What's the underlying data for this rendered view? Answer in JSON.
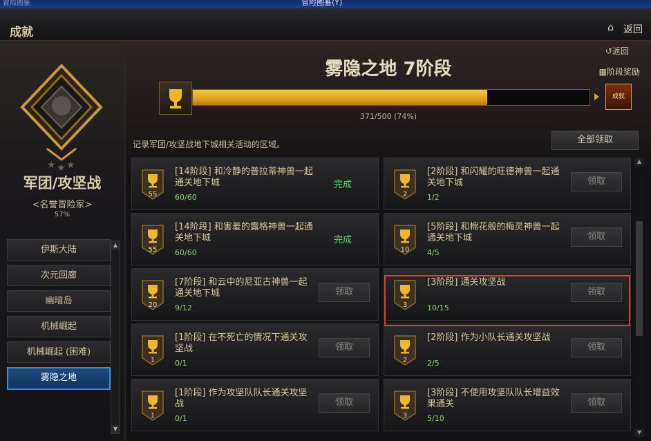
{
  "window": {
    "title": "冒险图鉴(Y)",
    "left_label": "冒险图鉴"
  },
  "header": {
    "title": "成就",
    "back_label": "返回"
  },
  "category": {
    "name": "军团/攻坚战",
    "honor": "<名誉冒险家>",
    "percent": "57%"
  },
  "zones": [
    {
      "label": "伊斯大陆",
      "active": false
    },
    {
      "label": "次元回廊",
      "active": false
    },
    {
      "label": "幽暗岛",
      "active": false
    },
    {
      "label": "机械崛起",
      "active": false
    },
    {
      "label": "机械崛起 (困难)",
      "active": false
    },
    {
      "label": "雾隐之地",
      "active": true
    }
  ],
  "main": {
    "stage_title": "雾隐之地  7阶段",
    "return_label": "返回",
    "stage_reward_label": "阶段奖励",
    "progress_text": "371/500 (74%)",
    "progress_fraction": 0.742,
    "reward_icon_label": "成就",
    "description": "记录军团/攻坚战地下城相关活动的区域。",
    "claim_all_label": "全部领取"
  },
  "achievements": [
    {
      "title": "[14阶段] 和冷静的普拉蒂神兽一起通关地下城",
      "progress": "60/60",
      "points": "55",
      "status": "完成"
    },
    {
      "title": "[2阶段] 和闪耀的旺德神兽一起通关地下城",
      "progress": "1/2",
      "points": "2",
      "status": "领取"
    },
    {
      "title": "[14阶段] 和害羞的露格神兽一起通关地下城",
      "progress": "60/60",
      "points": "55",
      "status": "完成"
    },
    {
      "title": "[5阶段] 和棉花般的梅灵神兽一起通关地下城",
      "progress": "4/5",
      "points": "10",
      "status": "领取"
    },
    {
      "title": "[7阶段] 和云中的尼亚古神兽一起通关地下城",
      "progress": "9/12",
      "points": "20",
      "status": "领取"
    },
    {
      "title": "[3阶段] 通关攻坚战",
      "progress": "10/15",
      "points": "3",
      "status": "领取"
    },
    {
      "title": "[1阶段] 在不死亡的情况下通关攻坚战",
      "progress": "0/1",
      "points": "1",
      "status": "领取"
    },
    {
      "title": "[2阶段] 作为小队长通关攻坚战",
      "progress": "2/5",
      "points": "2",
      "status": "领取"
    },
    {
      "title": "[1阶段] 作为攻坚队队长通关攻坚战",
      "progress": "0/1",
      "points": "1",
      "status": "领取"
    },
    {
      "title": "[3阶段] 不使用攻坚队队长增益效果通关",
      "progress": "5/10",
      "points": "3",
      "status": "领取"
    }
  ],
  "colors": {
    "accent_gold": "#dea21b",
    "complete_green": "#4fe06a",
    "progress_green": "#8fd26a",
    "highlight_red": "#e0393c",
    "active_blue": "#2f8fe4"
  }
}
